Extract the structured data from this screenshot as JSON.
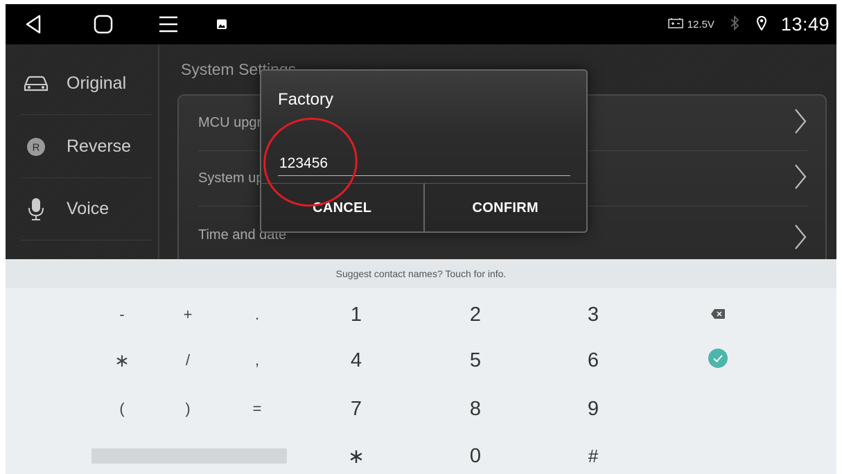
{
  "status_bar": {
    "icons": [
      "back-icon",
      "home-icon",
      "menu-icon",
      "gallery-icon",
      "battery-icon",
      "bluetooth-icon",
      "location-icon"
    ],
    "voltage": "12.5V",
    "clock": "13:49"
  },
  "sidebar": {
    "items": [
      {
        "label": "Original",
        "icon": "car-icon"
      },
      {
        "label": "Reverse",
        "icon": "reverse-r-icon"
      },
      {
        "label": "Voice",
        "icon": "microphone-icon"
      }
    ]
  },
  "settings": {
    "title": "System Settings",
    "rows": [
      {
        "label": "MCU upgrade"
      },
      {
        "label": "System upgrade"
      },
      {
        "label": "Time and date"
      }
    ]
  },
  "dialog": {
    "title": "Factory",
    "input_value": "123456",
    "cancel_label": "CANCEL",
    "confirm_label": "CONFIRM"
  },
  "keyboard": {
    "suggestion": "Suggest contact names? Touch for info.",
    "keys": {
      "minus": "-",
      "plus": "+",
      "dot": ".",
      "one": "1",
      "two": "2",
      "three": "3",
      "asterisk_sym": "∗",
      "slash": "/",
      "comma": ",",
      "four": "4",
      "five": "5",
      "six": "6",
      "paren_open": "(",
      "paren_close": ")",
      "equals": "=",
      "seven": "7",
      "eight": "8",
      "nine": "9",
      "asterisk": "∗",
      "zero": "0",
      "hash": "#"
    },
    "accent_color": "#4db6ac"
  },
  "annotation_color": "#e01b24"
}
